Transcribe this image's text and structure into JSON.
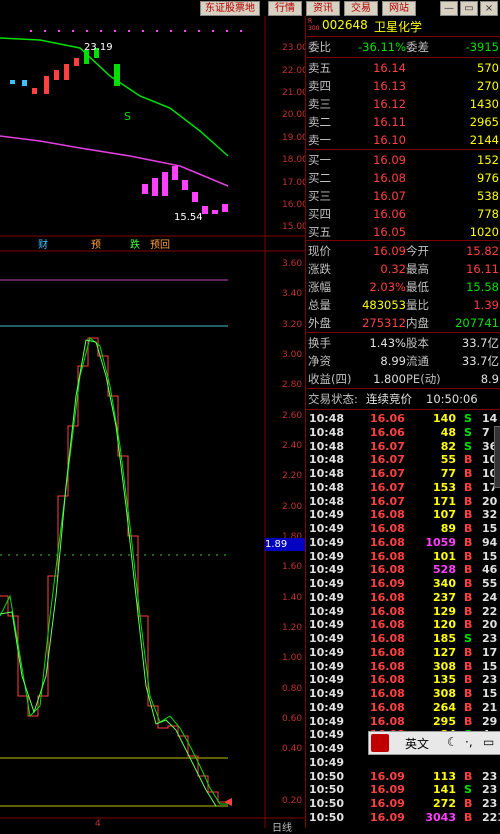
{
  "top_buttons": [
    "东证股票地",
    "行情",
    "资讯",
    "交易",
    "网站"
  ],
  "window_controls": {
    "minimize": "—",
    "restore": "▭",
    "close": "×"
  },
  "stock": {
    "badge_top": "R",
    "badge_bottom": "300",
    "code": "002648",
    "name": "卫星化学"
  },
  "ratio": {
    "label1": "委比",
    "value1": "-36.11%",
    "label2": "委差",
    "value2": "-3915"
  },
  "asks": [
    {
      "label": "卖五",
      "price": "16.14",
      "volume": "570"
    },
    {
      "label": "卖四",
      "price": "16.13",
      "volume": "270"
    },
    {
      "label": "卖三",
      "price": "16.12",
      "volume": "1430"
    },
    {
      "label": "卖二",
      "price": "16.11",
      "volume": "2965"
    },
    {
      "label": "卖一",
      "price": "16.10",
      "volume": "2144"
    }
  ],
  "bids": [
    {
      "label": "买一",
      "price": "16.09",
      "volume": "152"
    },
    {
      "label": "买二",
      "price": "16.08",
      "volume": "976"
    },
    {
      "label": "买三",
      "price": "16.07",
      "volume": "538"
    },
    {
      "label": "买四",
      "price": "16.06",
      "volume": "778"
    },
    {
      "label": "买五",
      "price": "16.05",
      "volume": "1020"
    }
  ],
  "stats": [
    {
      "l1": "现价",
      "v1": "16.09",
      "c1": "red",
      "l2": "今开",
      "v2": "15.82",
      "c2": "red"
    },
    {
      "l1": "涨跌",
      "v1": "0.32",
      "c1": "red",
      "l2": "最高",
      "v2": "16.11",
      "c2": "red"
    },
    {
      "l1": "涨幅",
      "v1": "2.03%",
      "c1": "red",
      "l2": "最低",
      "v2": "15.58",
      "c2": "green"
    },
    {
      "l1": "总量",
      "v1": "483053",
      "c1": "yellow",
      "l2": "量比",
      "v2": "1.39",
      "c2": "red"
    },
    {
      "l1": "外盘",
      "v1": "275312",
      "c1": "red",
      "l2": "内盘",
      "v2": "207741",
      "c2": "green"
    }
  ],
  "stats2": [
    {
      "l1": "换手",
      "v1": "1.43%",
      "l2": "股本",
      "v2": "33.7亿"
    },
    {
      "l1": "净资",
      "v1": "8.99",
      "l2": "流通",
      "v2": "33.7亿"
    },
    {
      "l1": "收益(四)",
      "v1": "1.800",
      "l2": "PE(动)",
      "v2": "8.9"
    }
  ],
  "trade_status": {
    "label": "交易状态:",
    "value": "连续竞价",
    "time": "10:50:06"
  },
  "ticks": [
    {
      "t": "10:48",
      "p": "16.06",
      "v": "140",
      "s": "S",
      "n": "14"
    },
    {
      "t": "10:48",
      "p": "16.06",
      "v": "48",
      "s": "S",
      "n": "7"
    },
    {
      "t": "10:48",
      "p": "16.07",
      "v": "82",
      "s": "S",
      "n": "36"
    },
    {
      "t": "10:48",
      "p": "16.07",
      "v": "55",
      "s": "B",
      "n": "10"
    },
    {
      "t": "10:48",
      "p": "16.07",
      "v": "77",
      "s": "B",
      "n": "10"
    },
    {
      "t": "10:48",
      "p": "16.07",
      "v": "153",
      "s": "B",
      "n": "17"
    },
    {
      "t": "10:48",
      "p": "16.07",
      "v": "171",
      "s": "B",
      "n": "20"
    },
    {
      "t": "10:49",
      "p": "16.08",
      "v": "107",
      "s": "B",
      "n": "32"
    },
    {
      "t": "10:49",
      "p": "16.08",
      "v": "89",
      "s": "B",
      "n": "15"
    },
    {
      "t": "10:49",
      "p": "16.08",
      "v": "1059",
      "s": "B",
      "n": "94"
    },
    {
      "t": "10:49",
      "p": "16.08",
      "v": "101",
      "s": "B",
      "n": "15"
    },
    {
      "t": "10:49",
      "p": "16.08",
      "v": "528",
      "s": "B",
      "n": "46"
    },
    {
      "t": "10:49",
      "p": "16.09",
      "v": "340",
      "s": "B",
      "n": "55"
    },
    {
      "t": "10:49",
      "p": "16.08",
      "v": "237",
      "s": "B",
      "n": "24"
    },
    {
      "t": "10:49",
      "p": "16.08",
      "v": "129",
      "s": "B",
      "n": "22"
    },
    {
      "t": "10:49",
      "p": "16.08",
      "v": "120",
      "s": "B",
      "n": "20"
    },
    {
      "t": "10:49",
      "p": "16.08",
      "v": "185",
      "s": "S",
      "n": "23"
    },
    {
      "t": "10:49",
      "p": "16.08",
      "v": "127",
      "s": "B",
      "n": "17"
    },
    {
      "t": "10:49",
      "p": "16.08",
      "v": "308",
      "s": "B",
      "n": "15"
    },
    {
      "t": "10:49",
      "p": "16.08",
      "v": "135",
      "s": "B",
      "n": "23"
    },
    {
      "t": "10:49",
      "p": "16.08",
      "v": "308",
      "s": "B",
      "n": "15"
    },
    {
      "t": "10:49",
      "p": "16.08",
      "v": "264",
      "s": "B",
      "n": "21"
    },
    {
      "t": "10:49",
      "p": "16.08",
      "v": "295",
      "s": "B",
      "n": "29"
    },
    {
      "t": "10:49",
      "p": "16.08",
      "v": "34",
      "s": "S",
      "n": "4"
    },
    {
      "t": "10:49",
      "p": "",
      "v": "",
      "s": "",
      "n": ""
    },
    {
      "t": "10:49",
      "p": "",
      "v": "",
      "s": "",
      "n": ""
    },
    {
      "t": "10:50",
      "p": "16.09",
      "v": "113",
      "s": "B",
      "n": "23"
    },
    {
      "t": "10:50",
      "p": "16.09",
      "v": "141",
      "s": "S",
      "n": "23"
    },
    {
      "t": "10:50",
      "p": "16.09",
      "v": "272",
      "s": "B",
      "n": "23"
    },
    {
      "t": "10:50",
      "p": "16.09",
      "v": "3043",
      "s": "B",
      "n": "221"
    }
  ],
  "ime": {
    "label": "英文"
  },
  "chart": {
    "price_axis": [
      "23.00",
      "22.00",
      "21.00",
      "20.00",
      "19.00",
      "18.00",
      "17.00",
      "16.00",
      "15.00"
    ],
    "indicator_axis": [
      "3.60",
      "3.40",
      "3.20",
      "3.00",
      "2.80",
      "2.60",
      "2.40",
      "2.20",
      "2.00",
      "1.80",
      "1.60",
      "1.40",
      "1.20",
      "1.00",
      "0.80",
      "0.60",
      "0.40",
      "0.20"
    ],
    "high_label": "23.19",
    "low_label": "15.54",
    "s_marker": "S",
    "current_value": "1.89",
    "event_tags": [
      "财",
      "预",
      "跌",
      "预回"
    ],
    "period_label": "日线",
    "bottom_tick": "4"
  },
  "colors": {
    "up": "#ff4040",
    "down": "#00e000",
    "ma1": "#00e000",
    "ma2": "#e040e0",
    "line_cyan": "#40c0c0",
    "line_magenta": "#c040c0",
    "line_yellow": "#c0c000"
  }
}
